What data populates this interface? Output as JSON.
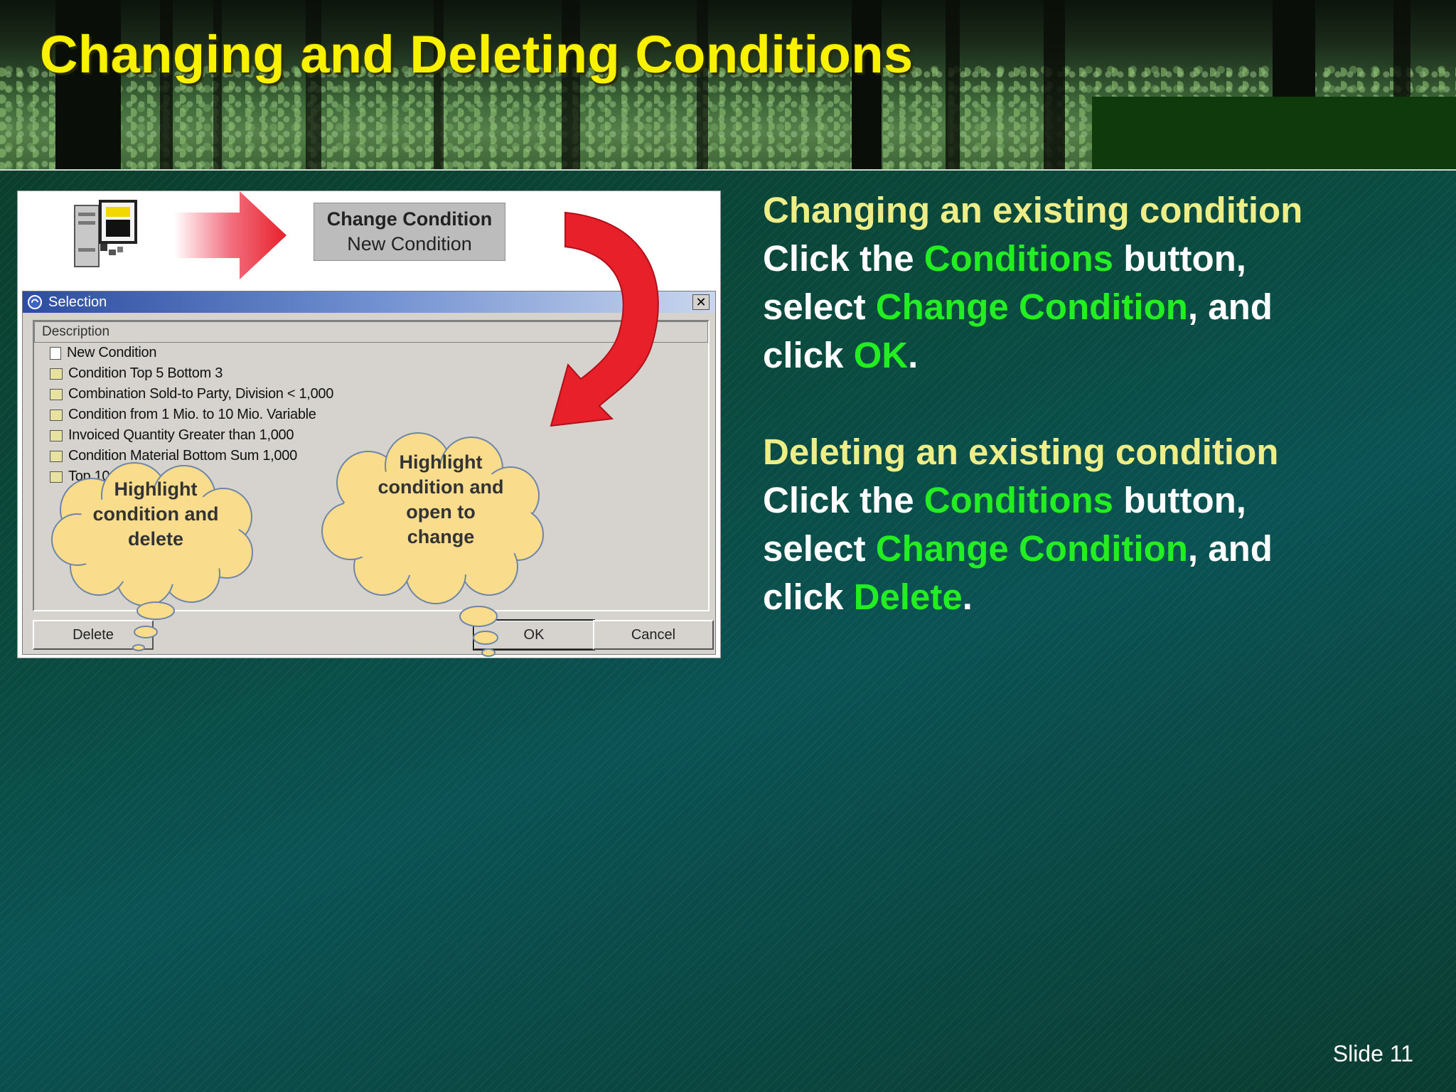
{
  "slide": {
    "title": "Changing and Deleting Conditions",
    "slide_number": "Slide 11"
  },
  "figure": {
    "button_group": {
      "line1": "Change Condition",
      "line2": "New Condition"
    },
    "dialog": {
      "title": "Selection",
      "close_label": "✕",
      "column_header": "Description",
      "items": [
        "New Condition",
        "Condition Top 5 Bottom 3",
        "Combination Sold-to Party, Division < 1,000",
        "Condition from 1 Mio. to 10 Mio. Variable",
        "Invoiced Quantity Greater than 1,000",
        "Condition Material Bottom Sum 1,000",
        "Top 100 %"
      ],
      "buttons": {
        "delete": "Delete",
        "ok": "OK",
        "cancel": "Cancel"
      }
    },
    "callouts": {
      "delete": {
        "l1": "Highlight",
        "l2": "condition and",
        "l3": "delete"
      },
      "change": {
        "l1": "Highlight",
        "l2": "condition and",
        "l3": "open to",
        "l4": "change"
      }
    },
    "colors": {
      "arrow": "#e8202a",
      "cloud": "#f9dc8c",
      "cloud_border": "#6f86a8"
    }
  },
  "text_panel": {
    "change": {
      "heading": "Changing an existing condition",
      "p1": "Click the ",
      "k1": "Conditions",
      "p2": " button,",
      "p3": "select ",
      "k2": "Change Condition",
      "p4": ", and",
      "p5": "click ",
      "k3": "OK",
      "p6": "."
    },
    "delete": {
      "heading": "Deleting an existing condition",
      "p1": "Click the ",
      "k1": "Conditions",
      "p2": " button,",
      "p3": "select ",
      "k2": "Change Condition",
      "p4": ", and",
      "p5": "click ",
      "k3": "Delete",
      "p6": "."
    }
  }
}
